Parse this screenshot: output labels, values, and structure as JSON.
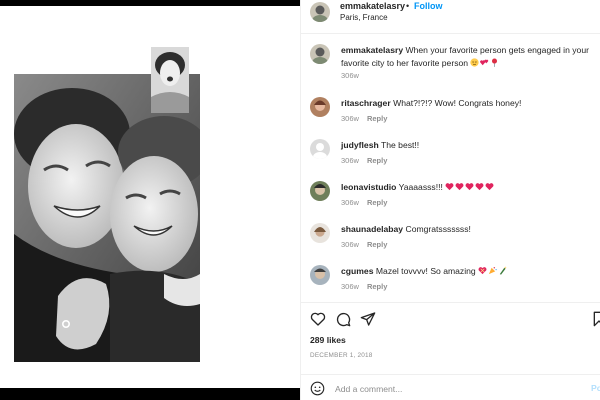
{
  "post": {
    "username": "emmakatelasry",
    "dot": "•",
    "follow_label": "Follow",
    "location": "Paris, France"
  },
  "caption": {
    "username": "emmakatelasry",
    "text": "When your favorite person gets engaged in your favorite city to her favorite person",
    "emojis": [
      "relieved-face",
      "revolving-hearts",
      "round-pushpin"
    ],
    "age": "306w"
  },
  "comments": [
    {
      "username": "ritaschrager",
      "text": "What?!?!? Wow! Congrats honey!",
      "emojis": [],
      "age": "306w",
      "reply_label": "Reply"
    },
    {
      "username": "judyflesh",
      "text": "The best!!",
      "emojis": [],
      "age": "306w",
      "reply_label": "Reply"
    },
    {
      "username": "leonavistudio",
      "text": "Yaaaasss!!!",
      "emojis": [
        "red-heart",
        "red-heart",
        "red-heart",
        "red-heart",
        "red-heart"
      ],
      "age": "306w",
      "reply_label": "Reply"
    },
    {
      "username": "shaunadelabay",
      "text": "Comgratsssssss!",
      "emojis": [],
      "age": "306w",
      "reply_label": "Reply"
    },
    {
      "username": "cgumes",
      "text": "Mazel tovvvv! So amazing",
      "emojis": [
        "heart-with-ribbon",
        "party-popper",
        "champagne"
      ],
      "age": "306w",
      "reply_label": "Reply"
    }
  ],
  "likes_text": "289 likes",
  "date_text": "DECEMBER 1, 2018",
  "add_comment": {
    "placeholder": "Add a comment...",
    "post_label": "Po"
  },
  "icons": {
    "like": "heart-outline-icon",
    "comment": "comment-bubble-icon",
    "share": "paper-plane-icon",
    "save": "bookmark-icon",
    "emoji": "smiley-icon"
  },
  "colors": {
    "link_blue": "#0095f6",
    "muted": "#8e8e8e",
    "text": "#262626",
    "heart_red": "#e0245e"
  }
}
